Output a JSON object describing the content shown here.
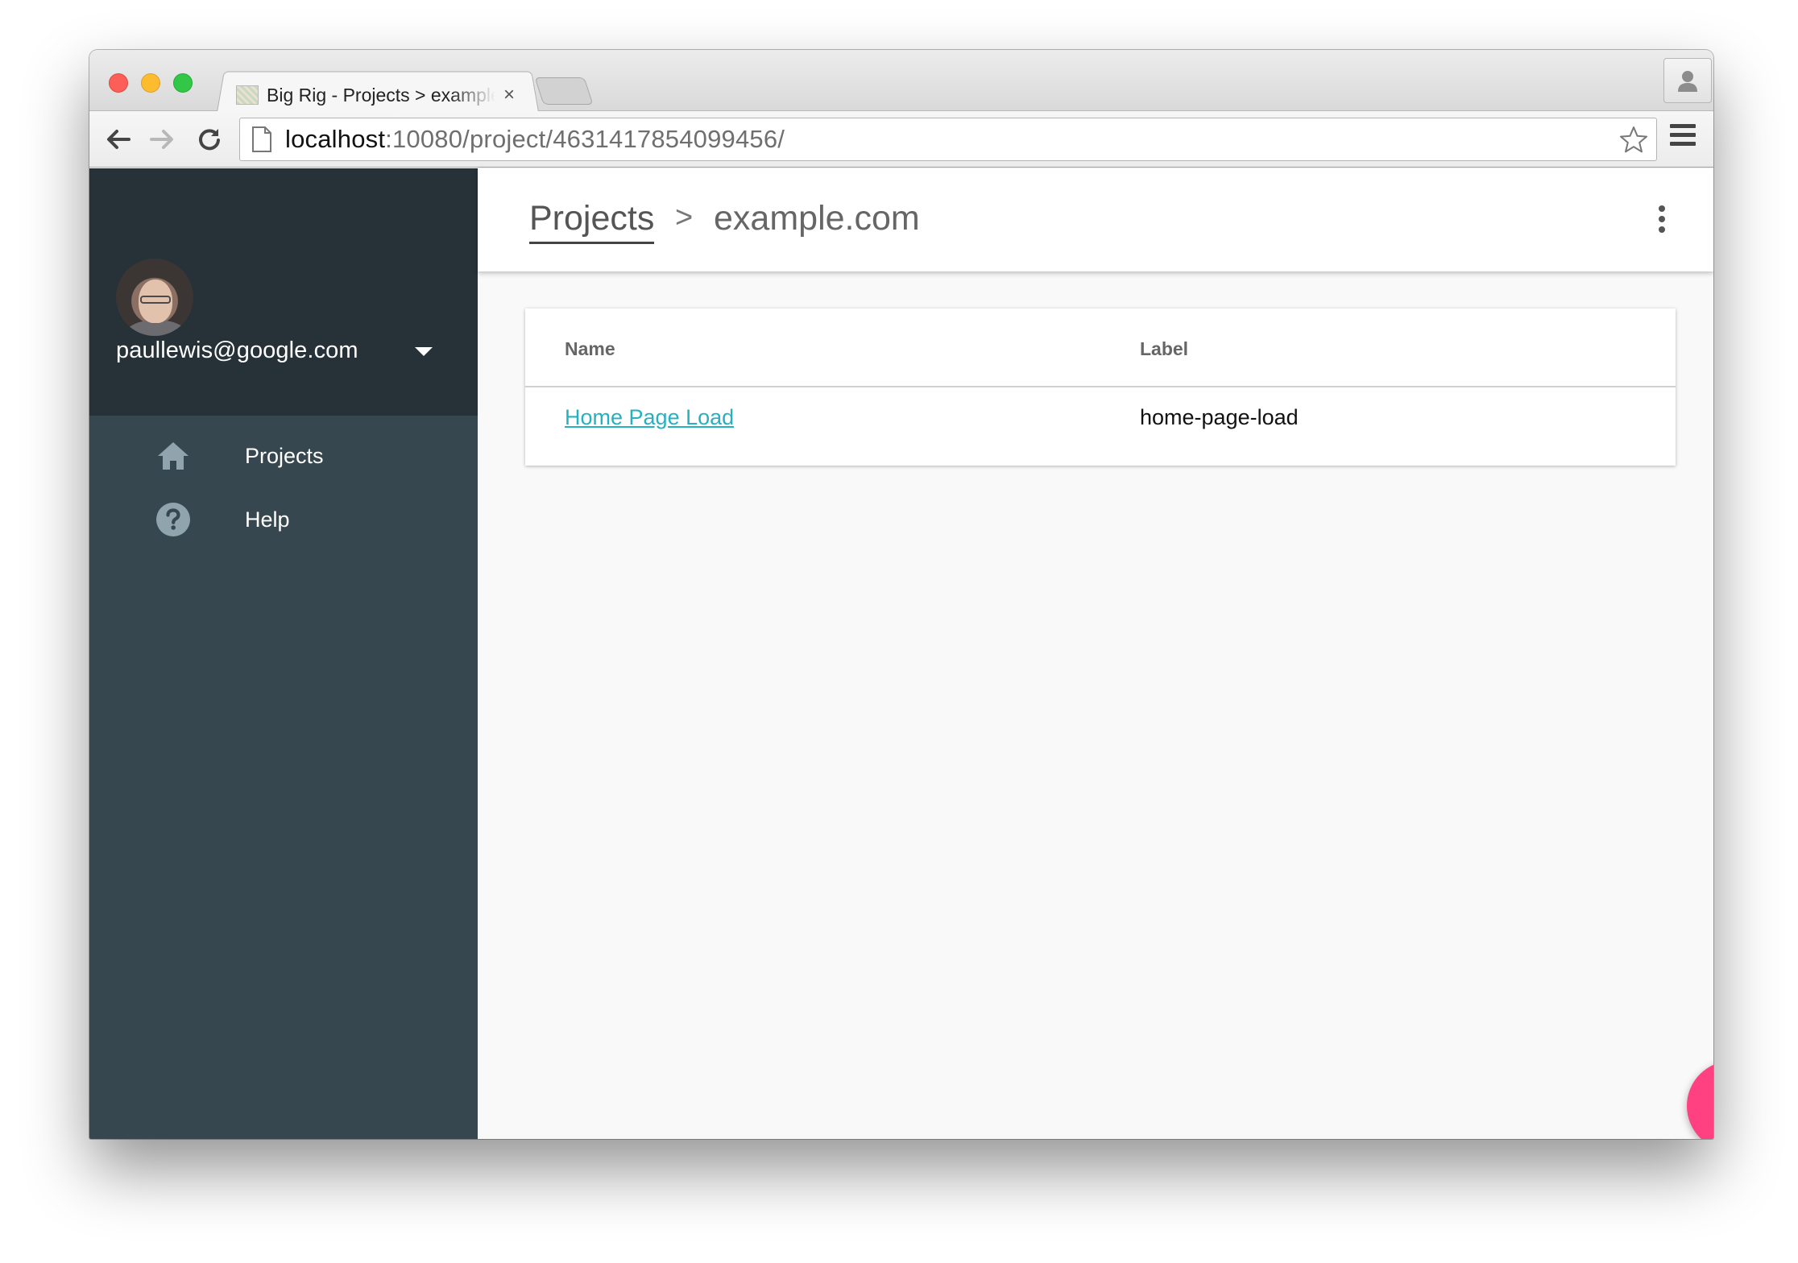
{
  "browser": {
    "tab_title": "Big Rig - Projects > example.com",
    "tab_close": "×",
    "url_host": "localhost",
    "url_rest": ":10080/project/4631417854099456/"
  },
  "sidebar": {
    "user_email": "paullewis@google.com",
    "items": [
      {
        "label": "Projects",
        "icon": "home-icon"
      },
      {
        "label": "Help",
        "icon": "help-icon"
      }
    ]
  },
  "header": {
    "breadcrumb_root": "Projects",
    "breadcrumb_separator": ">",
    "breadcrumb_current": "example.com"
  },
  "table": {
    "columns": [
      "Name",
      "Label"
    ],
    "rows": [
      {
        "name": "Home Page Load",
        "label": "home-page-load"
      }
    ]
  },
  "fab": {
    "icon": "upload-icon"
  },
  "colors": {
    "sidebar": "#37474f",
    "sidebar_header": "#263238",
    "link": "#26b1c0",
    "fab": "#ff4081"
  }
}
